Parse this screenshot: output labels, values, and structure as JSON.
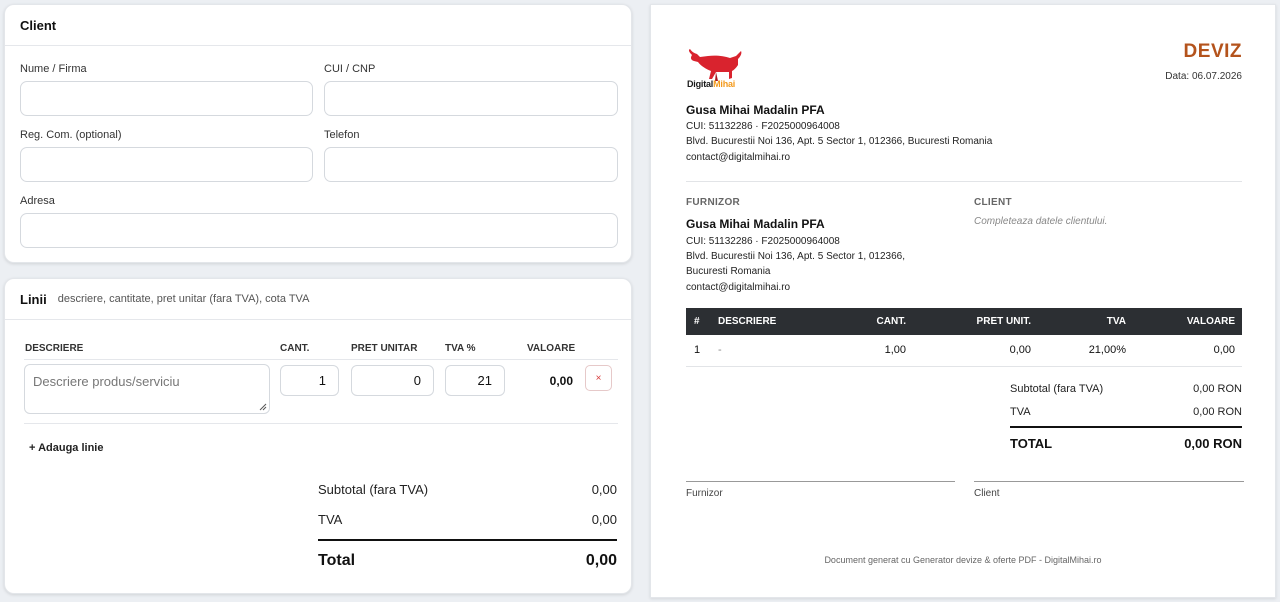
{
  "client_form": {
    "title": "Client",
    "name_label": "Nume / Firma",
    "cui_label": "CUI / CNP",
    "reg_label": "Reg. Com. (optional)",
    "phone_label": "Telefon",
    "address_label": "Adresa"
  },
  "lines_form": {
    "title": "Linii",
    "subtitle": "descriere, cantitate, pret unitar (fara TVA), cota TVA",
    "columns": [
      "DESCRIERE",
      "CANT.",
      "PRET UNITAR",
      "TVA %",
      "VALOARE"
    ],
    "row": {
      "description_placeholder": "Descriere produs/serviciu",
      "quantity": "1",
      "unit_price": "0",
      "vat": "21",
      "value": "0,00",
      "remove": "×"
    },
    "add_line": "+ Adauga linie",
    "subtotal_label": "Subtotal (fara TVA)",
    "subtotal_value": "0,00",
    "vat_label": "TVA",
    "vat_value": "0,00",
    "total_label": "Total",
    "total_value": "0,00"
  },
  "document": {
    "logo_text_1": "Digital",
    "logo_text_2": "Mihai",
    "title": "DEVIZ",
    "date": "Data: 06.07.2026",
    "issuer": {
      "name": "Gusa Mihai Madalin PFA",
      "ids": "CUI: 51132286 · F2025000964008",
      "address": "Blvd. Bucurestii Noi 136, Apt. 5 Sector 1, 012366, Bucuresti Romania",
      "email": "contact@digitalmihai.ro"
    },
    "supplier_label": "FURNIZOR",
    "supplier": {
      "name": "Gusa Mihai Madalin PFA",
      "ids": "CUI: 51132286 · F2025000964008",
      "address_line1": "Blvd. Bucurestii Noi 136, Apt. 5 Sector 1, 012366,",
      "address_line2": "Bucuresti Romania",
      "email": "contact@digitalmihai.ro"
    },
    "client_label": "CLIENT",
    "client_placeholder": "Completeaza datele clientului.",
    "table_headers": [
      "#",
      "DESCRIERE",
      "CANT.",
      "PRET UNIT.",
      "TVA",
      "VALOARE"
    ],
    "table_row": [
      "1",
      "-",
      "1,00",
      "0,00",
      "21,00%",
      "0,00"
    ],
    "subtotal_label": "Subtotal (fara TVA)",
    "subtotal_value": "0,00 RON",
    "vat_label": "TVA",
    "vat_value": "0,00 RON",
    "total_label": "TOTAL",
    "total_value": "0,00 RON",
    "sig_supplier": "Furnizor",
    "sig_client": "Client",
    "footer": "Document generat cu Generator devize & oferte PDF - DigitalMihai.ro"
  },
  "colors": {
    "accent": "#b4531c",
    "table_header": "#2c2f33",
    "logo_red": "#d9232e",
    "logo_orange": "#f39a1d"
  }
}
